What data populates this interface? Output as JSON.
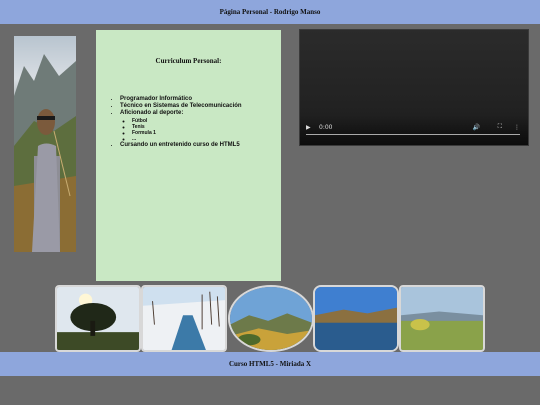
{
  "header": {
    "title": "Página Personal - Rodrigo Manso"
  },
  "profile": {
    "photo_icon": "profile-photo"
  },
  "cv": {
    "title": "Curriculum Personal:",
    "items": [
      "Programador Informático",
      "Técnico en Sistemas de Telecomunicación",
      "Aficionado al deporte:",
      "Cursando un entretenido curso de HTML5"
    ],
    "sports": [
      "Fútbol",
      "Tenis",
      "Formula 1",
      "..."
    ]
  },
  "video": {
    "time": "0:00",
    "play_icon": "play-icon",
    "volume_icon": "volume-icon",
    "fullscreen_icon": "fullscreen-icon",
    "menu_icon": "more-options-icon"
  },
  "gallery": {
    "images": [
      "tree-landscape",
      "snowy-river",
      "green-valley",
      "mountain-lake",
      "meadow-hills"
    ]
  },
  "footer": {
    "text": "Curso HTML5 - Miriada X"
  }
}
